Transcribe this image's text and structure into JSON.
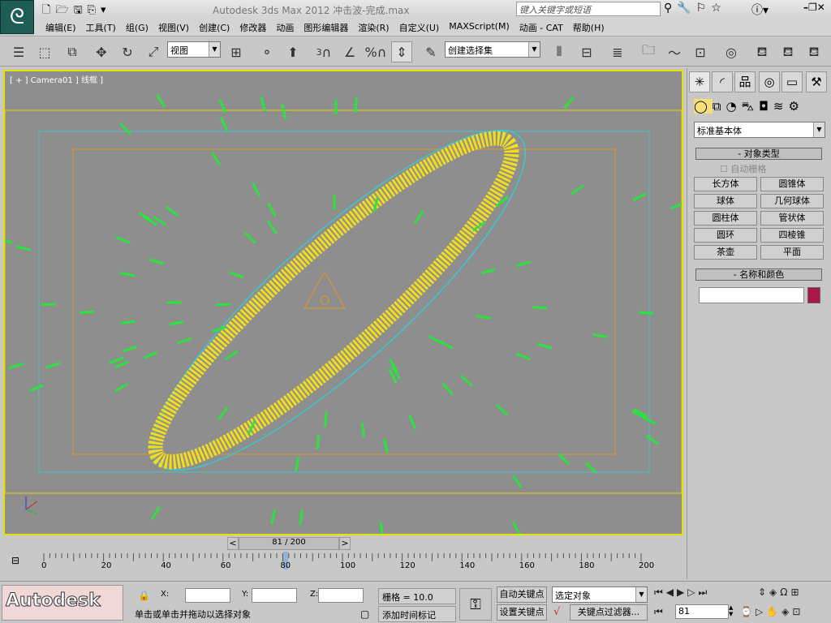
{
  "app": {
    "title": "Autodesk 3ds Max  2012     冲击波-完成.max",
    "search_placeholder": "键入关键字或短语"
  },
  "menu": [
    "编辑(E)",
    "工具(T)",
    "组(G)",
    "视图(V)",
    "创建(C)",
    "修改器",
    "动画",
    "图形编辑器",
    "渲染(R)",
    "自定义(U)",
    "MAXScript(M)",
    "动画 - CAT",
    "帮助(H)"
  ],
  "toolbar": {
    "ref_coord": "视图",
    "selection_set": "创建选择集",
    "snap_label": "3",
    "percent_label": "%"
  },
  "viewport": {
    "label": "[ + ] Camera01 ] 线框 ]",
    "colors": {
      "bg": "#8e8e8e",
      "particles_yellow": "#f2dc1e",
      "particles_green": "#27e83a",
      "safe_frame_cyan": "#3cc8d0",
      "safe_frame_orange": "#e09a2a"
    }
  },
  "command_panel": {
    "category": "标准基本体",
    "rollout_object_type": "对象类型",
    "autogrid": "自动栅格",
    "buttons": [
      "长方体",
      "圆锥体",
      "球体",
      "几何球体",
      "圆柱体",
      "管状体",
      "圆环",
      "四棱锥",
      "茶壶",
      "平面"
    ],
    "rollout_name_color": "名称和颜色",
    "name_value": "",
    "color": "#a8184a"
  },
  "timeline": {
    "current": "81 / 200",
    "frame": 81,
    "total": 200,
    "ticks": [
      "0",
      "20",
      "40",
      "60",
      "80",
      "100",
      "120",
      "140",
      "160",
      "180",
      "200"
    ]
  },
  "status": {
    "brand": "Autodesk",
    "prompt": "单击或单击并拖动以选择对象",
    "x_label": "X:",
    "y_label": "Y:",
    "z_label": "Z:",
    "grid": "栅格 = 10.0",
    "add_time_tag": "添加时间标记",
    "auto_key": "自动关键点",
    "set_key": "设置关键点",
    "selected": "选定对象",
    "key_filters": "关键点过滤器...",
    "frame_value": "81"
  }
}
